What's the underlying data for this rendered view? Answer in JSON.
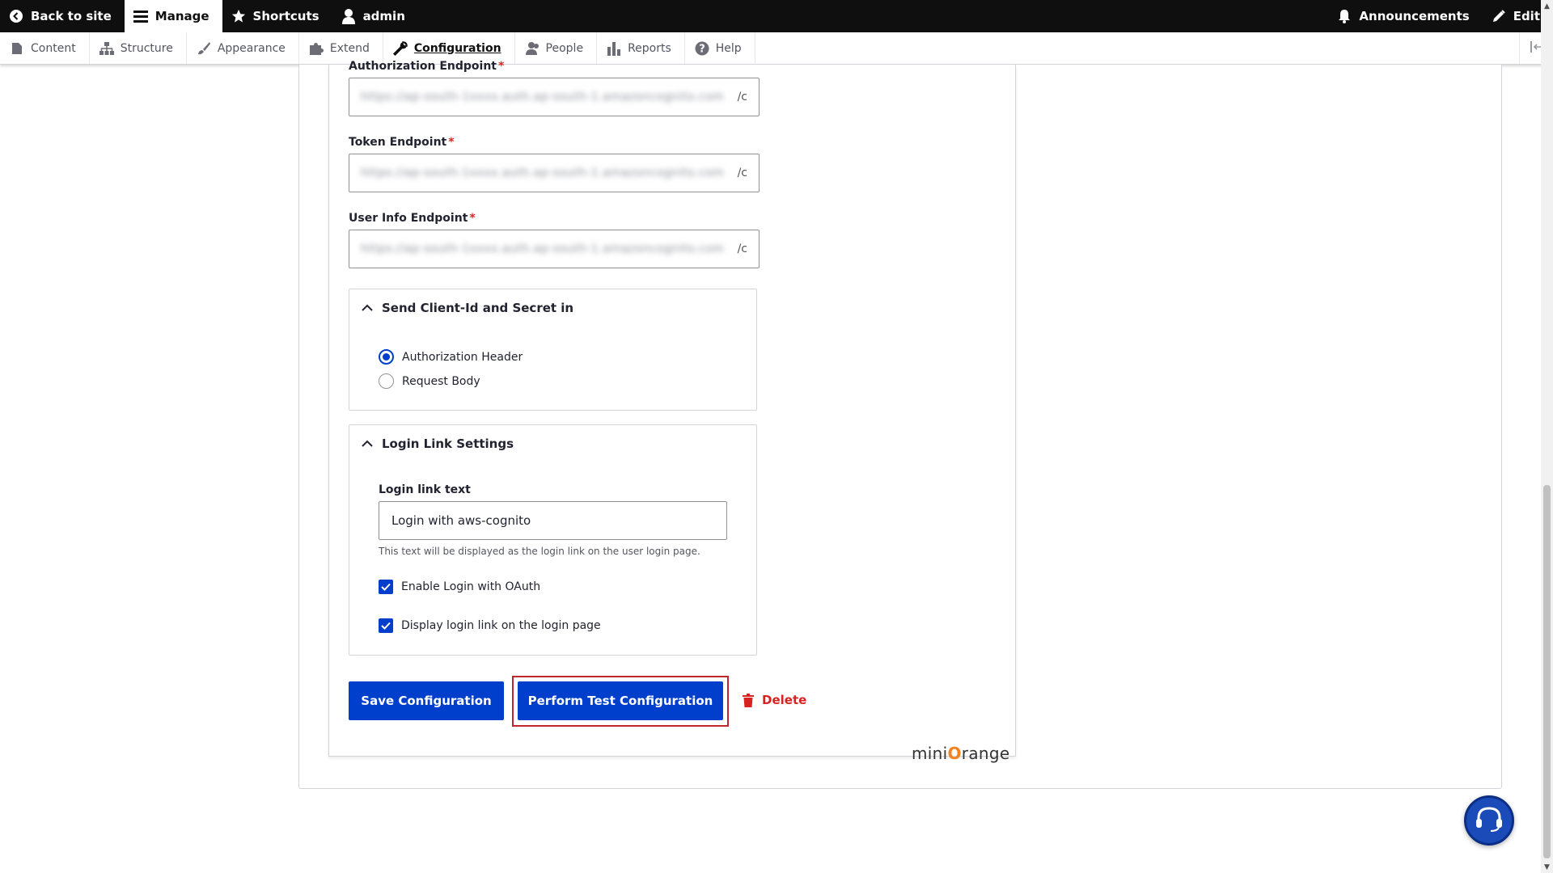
{
  "toolbar": {
    "back_to_site": "Back to site",
    "manage": "Manage",
    "shortcuts": "Shortcuts",
    "user": "admin",
    "announcements": "Announcements",
    "edit": "Edit"
  },
  "tray": {
    "items": [
      {
        "label": "Content",
        "icon": "file-icon"
      },
      {
        "label": "Structure",
        "icon": "sitemap-icon"
      },
      {
        "label": "Appearance",
        "icon": "brush-icon"
      },
      {
        "label": "Extend",
        "icon": "puzzle-icon"
      },
      {
        "label": "Configuration",
        "icon": "wrench-icon",
        "active": true
      },
      {
        "label": "People",
        "icon": "people-icon"
      },
      {
        "label": "Reports",
        "icon": "bar-chart-icon"
      },
      {
        "label": "Help",
        "icon": "help-icon"
      }
    ]
  },
  "form": {
    "authorization_endpoint": {
      "label": "Authorization Endpoint",
      "value": "https://ap-south-1xxxx.auth.ap-south-1.amazoncognito.com",
      "suffix": "/c"
    },
    "token_endpoint": {
      "label": "Token Endpoint",
      "value": "https://ap-south-1xxxx.auth.ap-south-1.amazoncognito.com",
      "suffix": "/c"
    },
    "user_info_endpoint": {
      "label": "User Info Endpoint",
      "value": "https://ap-south-1xxxx.auth.ap-south-1.amazoncognito.com",
      "suffix": "/c"
    },
    "required_mark": "*",
    "send_client": {
      "title": "Send Client-Id and Secret in",
      "options": [
        "Authorization Header",
        "Request Body"
      ],
      "selected": "Authorization Header"
    },
    "login_link": {
      "title": "Login Link Settings",
      "text_label": "Login link text",
      "text_value": "Login with aws-cognito",
      "help": "This text will be displayed as the login link on the user login page.",
      "enable_oauth": "Enable Login with OAuth",
      "display_link": "Display login link on the login page"
    }
  },
  "actions": {
    "save": "Save Configuration",
    "test": "Perform Test Configuration",
    "delete": "Delete"
  },
  "logo": {
    "pre": "mini",
    "o": "O",
    "post": "range"
  },
  "colors": {
    "primary": "#003ecc",
    "danger": "#d72222",
    "highlight": "#c0272d",
    "toolbar": "#0f0f0f"
  }
}
